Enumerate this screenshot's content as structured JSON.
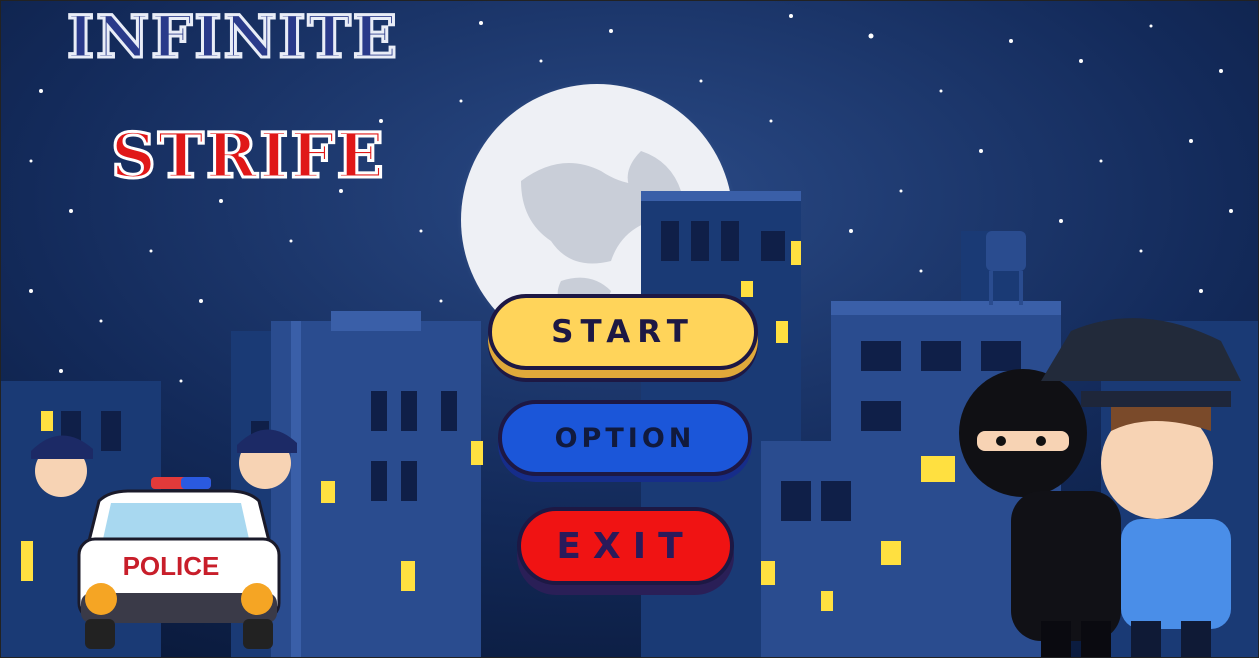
{
  "game": {
    "title_line1": "INFINITE",
    "title_line2": "STRIFE"
  },
  "menu": {
    "start_label": "START",
    "option_label": "OPTION",
    "exit_label": "EXIT"
  },
  "scene": {
    "police_car_label": "POLICE"
  },
  "colors": {
    "sky": "#0f2350",
    "start_button": "#ffd45a",
    "option_button": "#1b56d9",
    "exit_button": "#f01313",
    "title_line1": "#2a3a8a",
    "title_line2": "#e01818"
  }
}
